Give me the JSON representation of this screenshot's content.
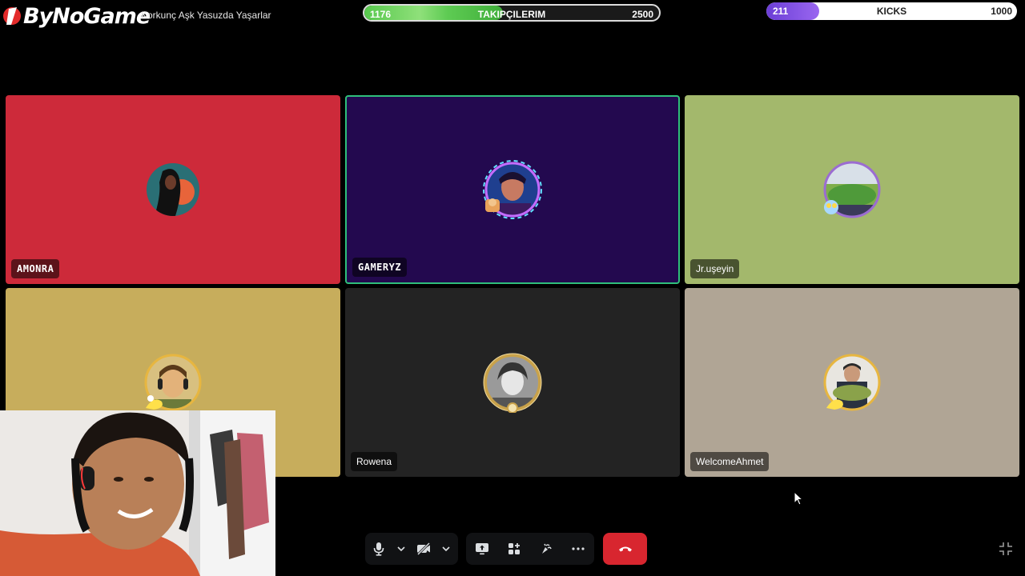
{
  "overlay": {
    "logo_text": "ByNoGame",
    "stream_title": "Korkunç Aşk Yasuzda Yaşarlar",
    "followers_goal": {
      "label": "TAKIPÇILERIM",
      "current": "1176",
      "target": "2500",
      "progress": 0.47
    },
    "kicks_goal": {
      "label": "KICKS",
      "current": "211",
      "target": "1000",
      "progress": 0.21
    }
  },
  "participants": [
    {
      "name": "AMONRA",
      "bg": "#cd2a3a",
      "speaking": false
    },
    {
      "name": "GAMERYZ",
      "bg": "#23094f",
      "speaking": true
    },
    {
      "name": "Jr.uşeyin",
      "bg": "#a3b86c",
      "speaking": false
    },
    {
      "name": "",
      "bg": "#c7ad5c",
      "speaking": false
    },
    {
      "name": "Rowena",
      "bg": "#232323",
      "speaking": false
    },
    {
      "name": "WelcomeAhmet",
      "bg": "#b0a595",
      "speaking": false
    }
  ],
  "controls": {
    "mic": "microphone-icon",
    "camera": "camera-off-icon",
    "screen_share": "screen-share-icon",
    "activities": "activities-icon",
    "soundboard": "soundboard-icon",
    "more": "more-icon",
    "hangup": "hangup-icon",
    "fullscreen": "fullscreen-exit-icon"
  },
  "colors": {
    "hangup": "#d8262f",
    "speaking_border": "#2fbf7b",
    "control_bg": "#111214"
  }
}
